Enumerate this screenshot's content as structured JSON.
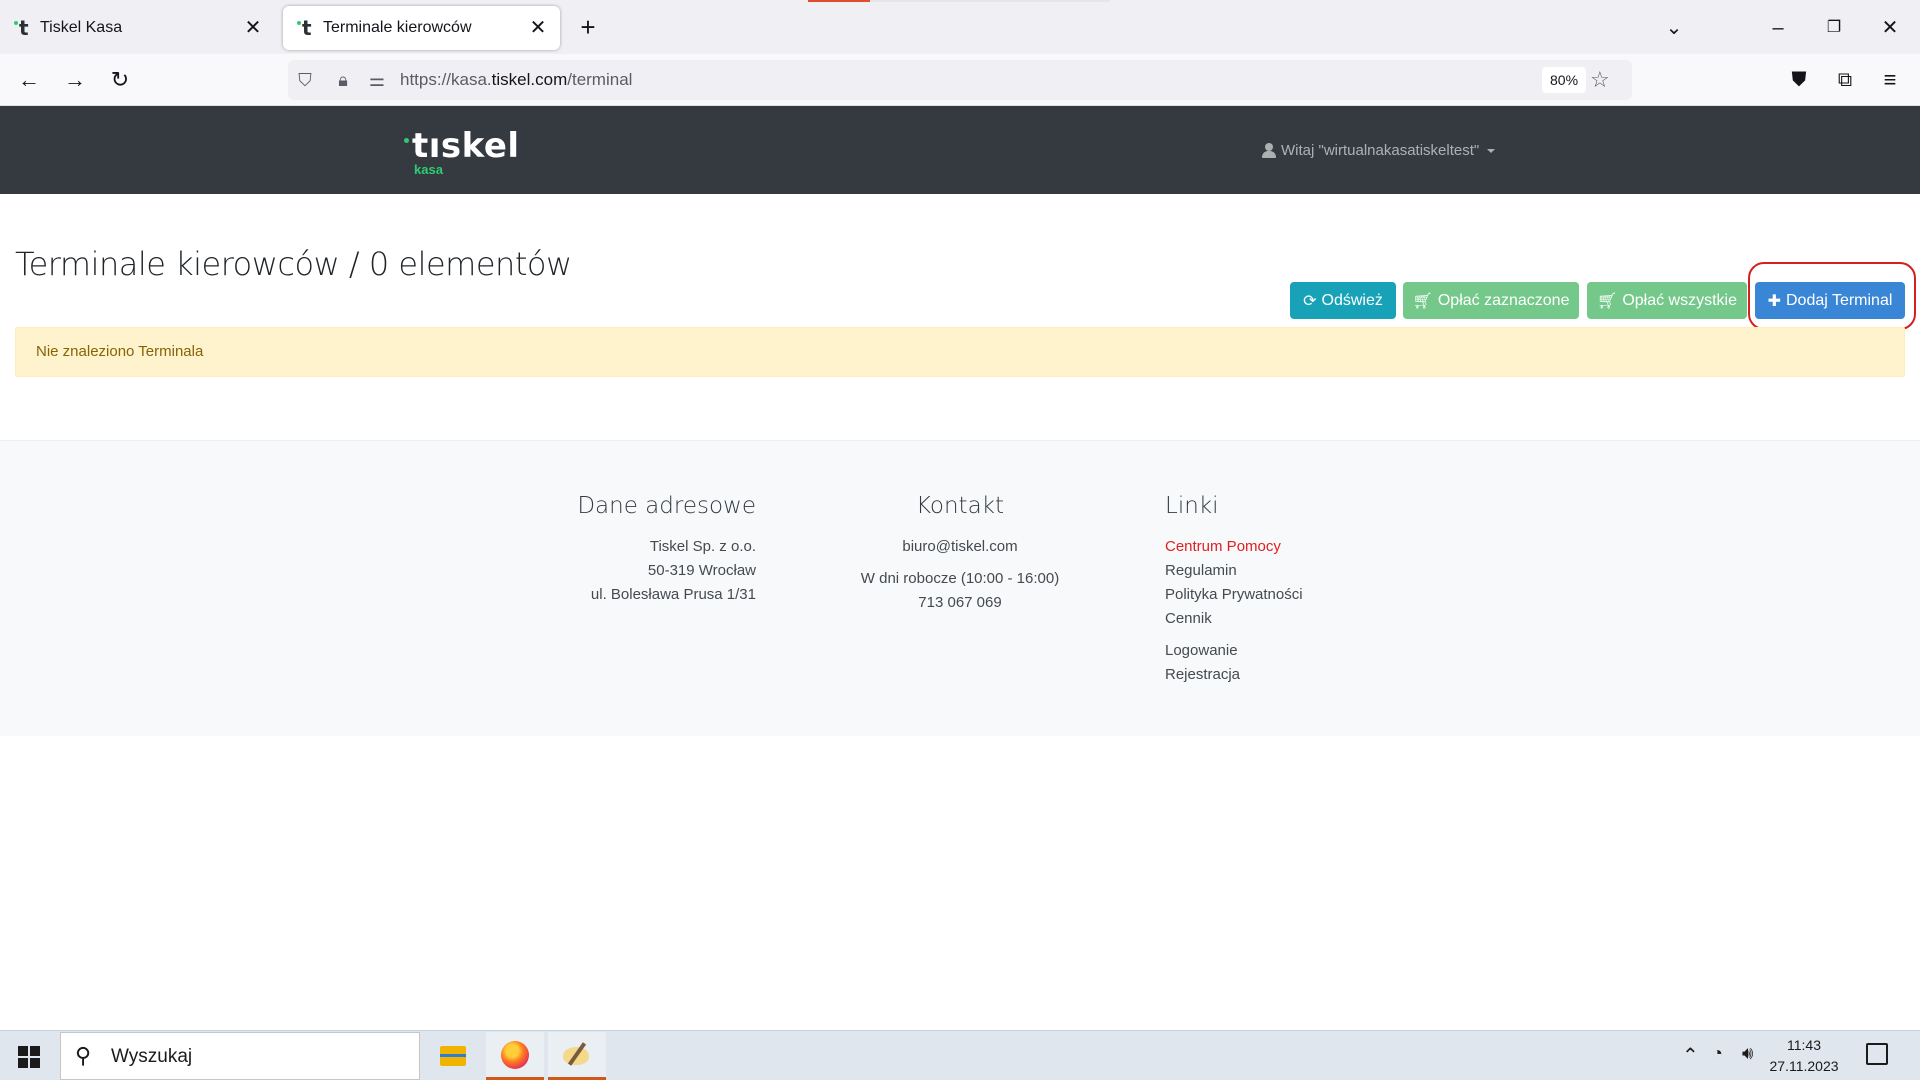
{
  "browser": {
    "tabs": [
      {
        "title": "Tiskel Kasa",
        "active": false
      },
      {
        "title": "Terminale kierowców",
        "active": true
      }
    ],
    "url_prefix": "https://kasa.",
    "url_host": "tiskel.com",
    "url_path": "/terminal",
    "zoom": "80%"
  },
  "site": {
    "logo_word": "tıskel",
    "logo_sub": "kasa",
    "user_greeting": "Witaj \"wirtualnakasatiskeltest\""
  },
  "page": {
    "title": "Terminale kierowców / 0 elementów",
    "buttons": {
      "refresh": "Odśwież",
      "pay_selected": "Opłać zaznaczone",
      "pay_all": "Opłać wszystkie",
      "add_terminal": "Dodaj Terminal"
    },
    "empty_message": "Nie znaleziono Terminala"
  },
  "footer": {
    "address": {
      "heading": "Dane adresowe",
      "lines": [
        "Tiskel Sp. z o.o.",
        "50-319 Wrocław",
        "ul. Bolesława Prusa 1/31"
      ]
    },
    "contact": {
      "heading": "Kontakt",
      "email": "biuro@tiskel.com",
      "hours": "W dni robocze (10:00 - 16:00)",
      "phone": "713 067 069"
    },
    "links": {
      "heading": "Linki",
      "items": [
        "Centrum Pomocy",
        "Regulamin",
        "Polityka Prywatności",
        "Cennik"
      ],
      "auth_items": [
        "Logowanie",
        "Rejestracja"
      ]
    }
  },
  "taskbar": {
    "search_placeholder": "Wyszukaj",
    "time": "11:43",
    "date": "27.11.2023"
  },
  "colors": {
    "header_bg": "#343a40",
    "refresh_btn": "#17a2b8",
    "pay_btn": "#74c98a",
    "add_btn": "#3a86d6",
    "alert_bg": "#fff3cd",
    "highlight_ring": "#d42020"
  }
}
